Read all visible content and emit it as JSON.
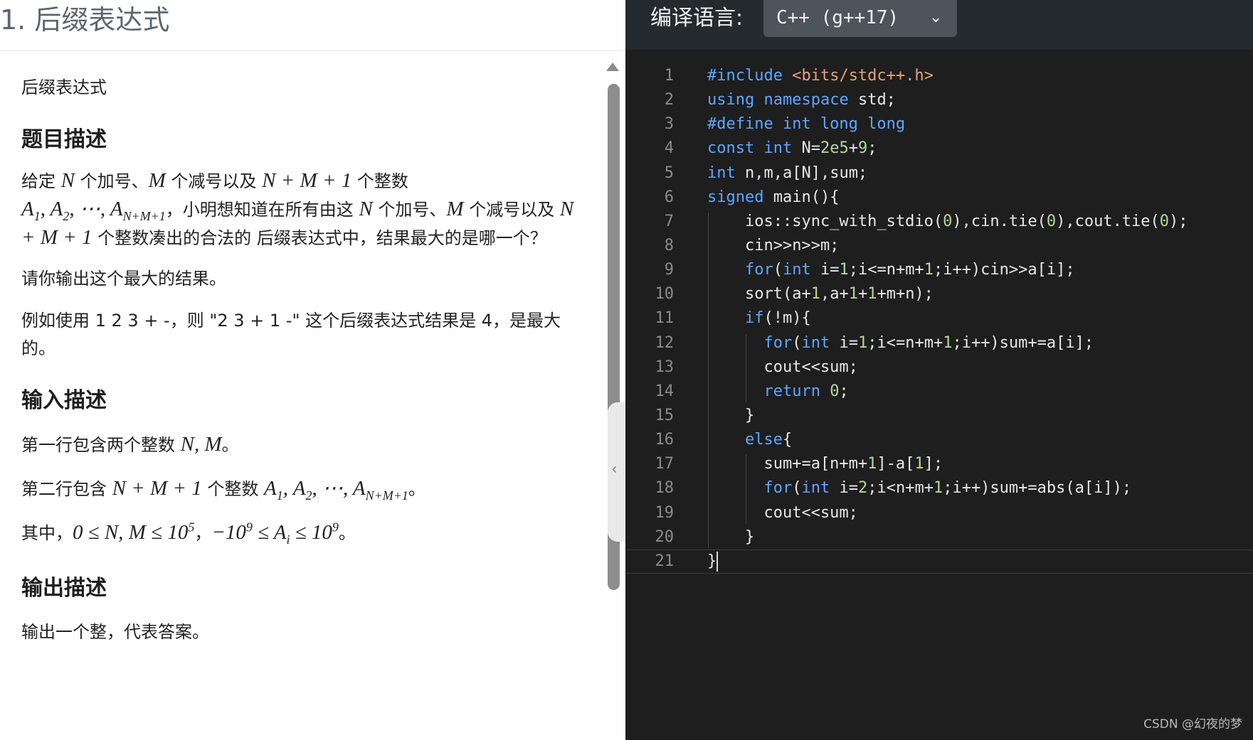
{
  "problem": {
    "title": "1. 后缀表达式",
    "subtitle": "后缀表达式",
    "section_desc": "题目描述",
    "desc_p1_a": "给定 ",
    "var_N": "N",
    "desc_p1_b": " 个加号、",
    "var_M": "M",
    "desc_p1_c": " 个减号以及 ",
    "expr_NM1": "N + M + 1",
    "desc_p1_d": " 个整数",
    "expr_A_seq_a": "A",
    "sub_1": "1",
    "sub_2": "2",
    "expr_A_dots": ", A",
    "expr_A_end": ", ⋯, A",
    "sub_NM1": "N+M+1",
    "desc_p1_e": "，小明想知道在所有由这 ",
    "desc_p1_f": " 个加号、",
    "desc_p1_g": " 个减号以及 ",
    "desc_p1_h": " 个整数凑出的合法的 后缀表达式中，结果最大的是哪一个？",
    "desc_p2": "请你输出这个最大的结果。",
    "desc_p3": "例如使用 1 2 3 + -，则 \"2 3 + 1 -\" 这个后缀表达式结果是 4，是最大的。",
    "section_input": "输入描述",
    "input_p1_a": "第一行包含两个整数 ",
    "input_p1_math": "N, M",
    "input_p1_b": "。",
    "input_p2_a": "第二行包含 ",
    "input_p2_b": " 个整数 ",
    "input_p2_c": "。",
    "input_p3_a": "其中，",
    "input_p3_m1": "0 ≤ N, M ≤ 10",
    "exp_5": "5",
    "input_p3_sep": "，",
    "input_p3_m2a": "−10",
    "exp_9": "9",
    "input_p3_m2b": " ≤ A",
    "sub_i": "i",
    "input_p3_m2c": " ≤ 10",
    "input_p3_b": "。",
    "section_output": "输出描述",
    "output_p1": "输出一个整，代表答案。"
  },
  "editor": {
    "lang_label": "编译语言:",
    "lang_value": "C++ (g++17)",
    "chevron_icon": "chevron-down-icon",
    "watermark": "CSDN @幻夜的梦"
  },
  "code_lines": [
    "#include <bits/stdc++.h>",
    "using namespace std;",
    "#define int long long",
    "const int N=2e5+9;",
    "int n,m,a[N],sum;",
    "signed main(){",
    "    ios::sync_with_stdio(0),cin.tie(0),cout.tie(0);",
    "    cin>>n>>m;",
    "    for(int i=1;i<=n+m+1;i++)cin>>a[i];",
    "    sort(a+1,a+1+1+m+n);",
    "    if(!m){",
    "      for(int i=1;i<=n+m+1;i++)sum+=a[i];",
    "      cout<<sum;",
    "      return 0;",
    "    }",
    "    else{",
    "      sum+=a[n+m+1]-a[1];",
    "      for(int i=2;i<n+m+1;i++)sum+=abs(a[i]);",
    "      cout<<sum;",
    "    }",
    "}"
  ],
  "colors": {
    "keyword": "#5fa6ff",
    "string": "#e6a27a",
    "number": "#b8d79a",
    "editor_bg": "#1e1e1e"
  }
}
